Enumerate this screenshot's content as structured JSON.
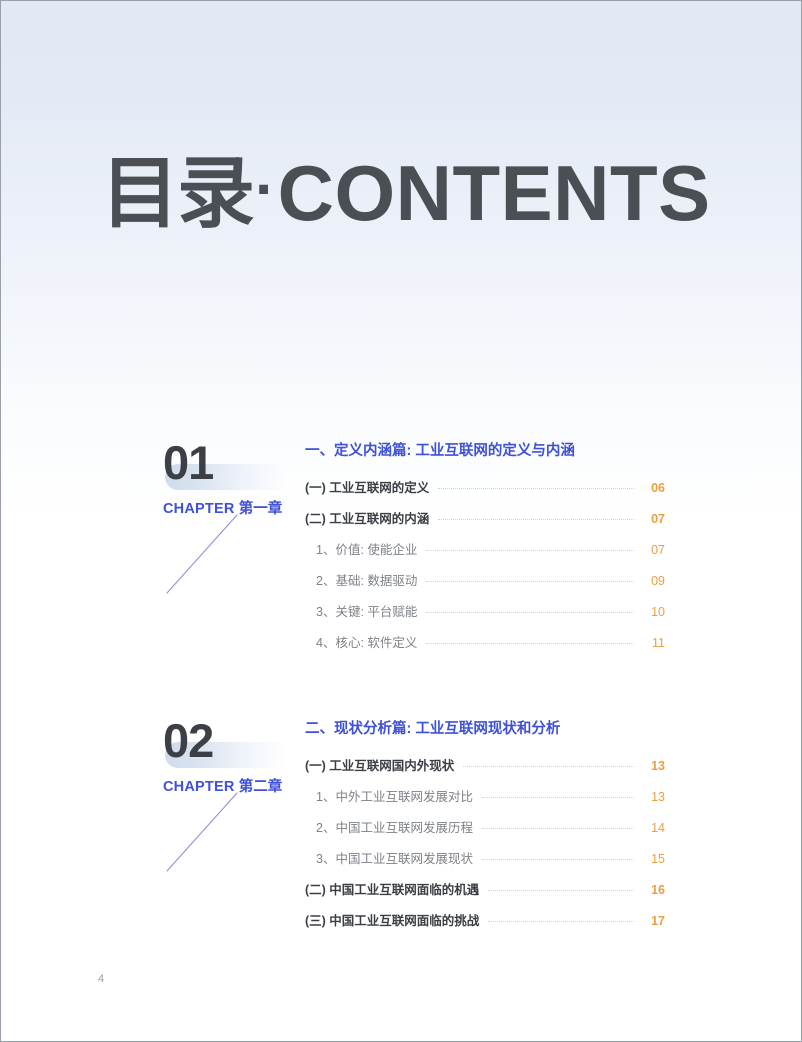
{
  "page": {
    "title_cn": "目录",
    "title_separator": "·",
    "title_en": "CONTENTS",
    "page_number": "4",
    "accent_blue": "#3f51d6",
    "accent_orange": "#e8a042",
    "title_color": "#4b4f54",
    "background_top": "#e2e8f4",
    "background_bottom": "#ffffff"
  },
  "chapters": [
    {
      "number": "01",
      "chapter_label_en": "CHAPTER",
      "chapter_label_cn": "第一章",
      "heading": "一、定义内涵篇: 工业互联网的定义与内涵",
      "entries": [
        {
          "level": 1,
          "text": "(一) 工业互联网的定义",
          "page": "06"
        },
        {
          "level": 1,
          "text": "(二) 工业互联网的内涵",
          "page": "07"
        },
        {
          "level": 2,
          "text": "1、价值: 使能企业",
          "page": "07"
        },
        {
          "level": 2,
          "text": "2、基础: 数据驱动",
          "page": "09"
        },
        {
          "level": 2,
          "text": "3、关键: 平台赋能",
          "page": "10"
        },
        {
          "level": 2,
          "text": "4、核心: 软件定义",
          "page": "11"
        }
      ]
    },
    {
      "number": "02",
      "chapter_label_en": "CHAPTER",
      "chapter_label_cn": "第二章",
      "heading": "二、现状分析篇: 工业互联网现状和分析",
      "entries": [
        {
          "level": 1,
          "text": "(一) 工业互联网国内外现状",
          "page": "13"
        },
        {
          "level": 2,
          "text": "1、中外工业互联网发展对比",
          "page": "13"
        },
        {
          "level": 2,
          "text": "2、中国工业互联网发展历程",
          "page": "14"
        },
        {
          "level": 2,
          "text": "3、中国工业互联网发展现状",
          "page": "15"
        },
        {
          "level": 1,
          "text": "(二) 中国工业互联网面临的机遇",
          "page": "16"
        },
        {
          "level": 1,
          "text": "(三) 中国工业互联网面临的挑战",
          "page": "17"
        }
      ]
    }
  ]
}
